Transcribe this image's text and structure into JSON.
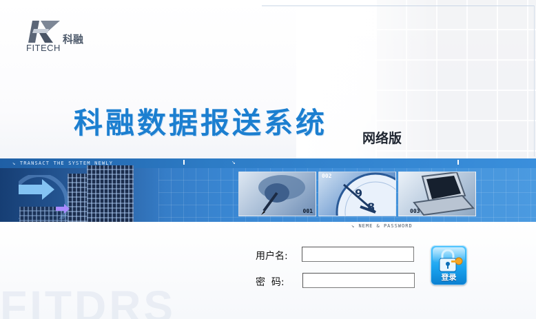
{
  "brand": {
    "logo_en": "FITECH",
    "logo_cn": "科融"
  },
  "header": {
    "title": "科融数据报送系统",
    "edition": "网络版"
  },
  "banner": {
    "tagline": "TRANSACT THE SYSTEM NEWLY",
    "thumbnails": [
      {
        "number": "001"
      },
      {
        "number": "002"
      },
      {
        "number": "003"
      }
    ]
  },
  "login": {
    "section_tagline": "NEME & PASSWORD",
    "username_label": "用户名:",
    "username_value": "",
    "password_label": "密  码:",
    "password_value": "",
    "login_button_label": "登录"
  },
  "watermark": "FITDRS",
  "icons": {
    "login": "lock-key-icon",
    "tagline_marker": "arrow-down-right-icon"
  },
  "colors": {
    "title_blue": "#1c7fd0",
    "banner_blue": "#3b8fd8",
    "button_blue": "#1ba4ef",
    "key_orange": "#f5a623"
  }
}
